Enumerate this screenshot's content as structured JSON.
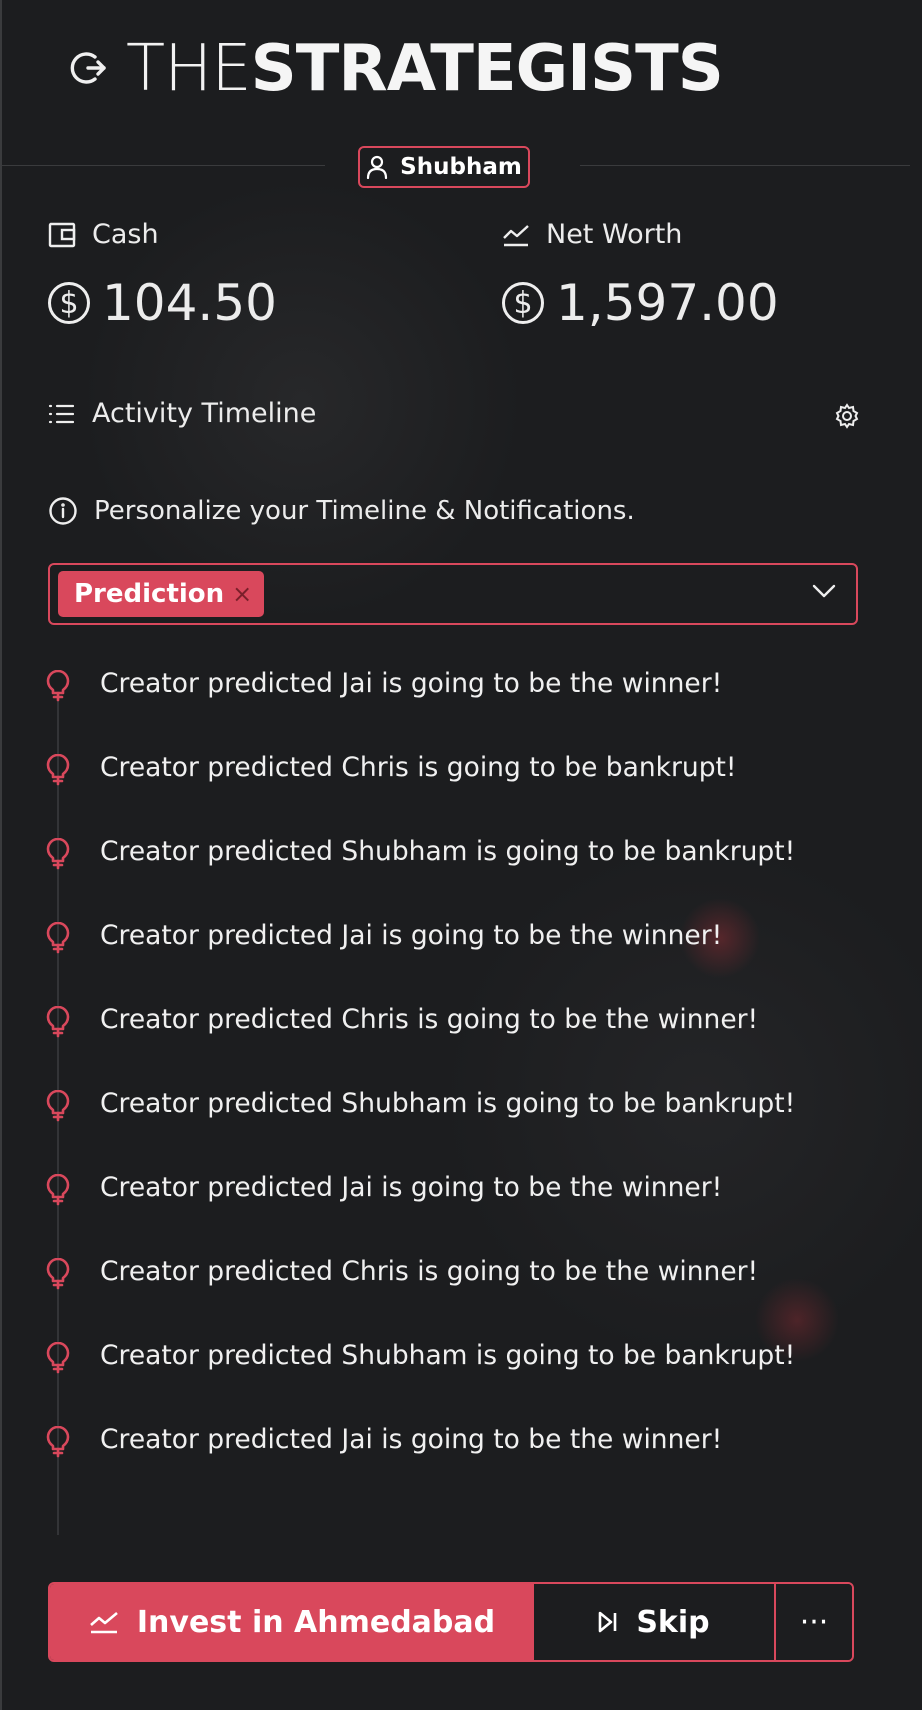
{
  "header": {
    "title_prefix": "THE",
    "title_suffix": "STRATEGISTS",
    "user_name": "Shubham"
  },
  "stats": {
    "cash_label": "Cash",
    "cash_value": "104.50",
    "networth_label": "Net Worth",
    "networth_value": "1,597.00",
    "currency_symbol": "$"
  },
  "activity": {
    "title": "Activity Timeline",
    "personalize_text": "Personalize your Timeline & Notifications.",
    "filter_chip": "Prediction",
    "chip_remove": "×",
    "items": [
      "Creator predicted Jai is going to be the winner!",
      "Creator predicted Chris is going to be bankrupt!",
      "Creator predicted Shubham is going to be bankrupt!",
      "Creator predicted Jai is going to be the winner!",
      "Creator predicted Chris is going to be the winner!",
      "Creator predicted Shubham is going to be bankrupt!",
      "Creator predicted Jai is going to be the winner!",
      "Creator predicted Chris is going to be the winner!",
      "Creator predicted Shubham is going to be bankrupt!",
      "Creator predicted Jai is going to be the winner!"
    ]
  },
  "actions": {
    "invest_label": "Invest in Ahmedabad",
    "skip_label": "Skip",
    "more_label": "···"
  },
  "colors": {
    "accent": "#d9485c",
    "background": "#1c1d1f",
    "text": "#ececec"
  },
  "icons": [
    "logout-icon",
    "user-icon",
    "wallet-icon",
    "chart-line-icon",
    "dollar-circle-icon",
    "list-icon",
    "gear-icon",
    "info-icon",
    "chevron-down-icon",
    "lightbulb-icon",
    "skip-forward-icon",
    "more-icon"
  ]
}
